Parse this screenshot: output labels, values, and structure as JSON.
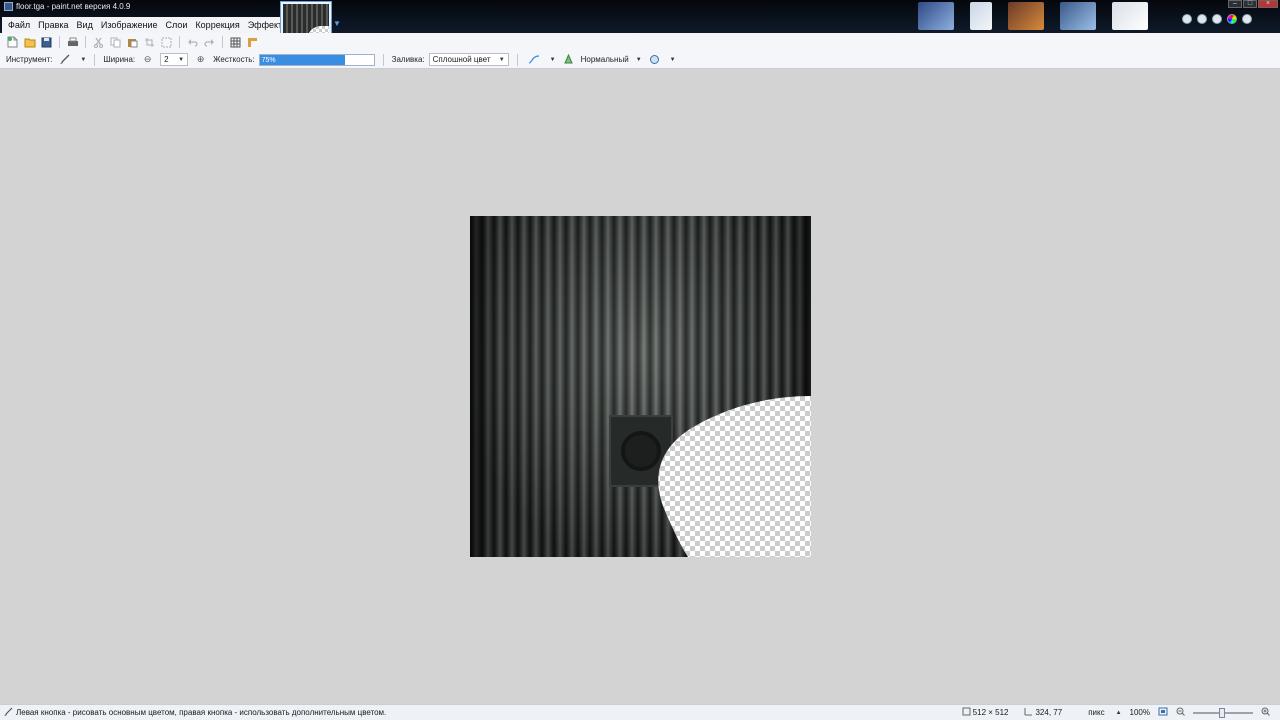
{
  "window": {
    "title": "floor.tga - paint.net версия 4.0.9"
  },
  "menu": {
    "items": [
      "Файл",
      "Правка",
      "Вид",
      "Изображение",
      "Слои",
      "Коррекция",
      "Эффекты"
    ]
  },
  "toolbar": {
    "tool_label": "Инструмент:",
    "width_label": "Ширина:",
    "width_value": "2",
    "hardness_label": "Жесткость:",
    "hardness_value": "75%",
    "hardness_fraction": 0.75,
    "fill_label": "Заливка:",
    "fill_value": "Сплошной цвет",
    "blend_value": "Нормальный"
  },
  "status": {
    "hint": "Левая кнопка - рисовать основным цветом, правая кнопка - использовать дополнительным цветом.",
    "image_size": "512 × 512",
    "cursor_pos": "324, 77",
    "units": "пикс",
    "zoom": "100%"
  },
  "colors": {
    "accent": "#3a8ee2",
    "workspace": "#d3d3d3"
  }
}
